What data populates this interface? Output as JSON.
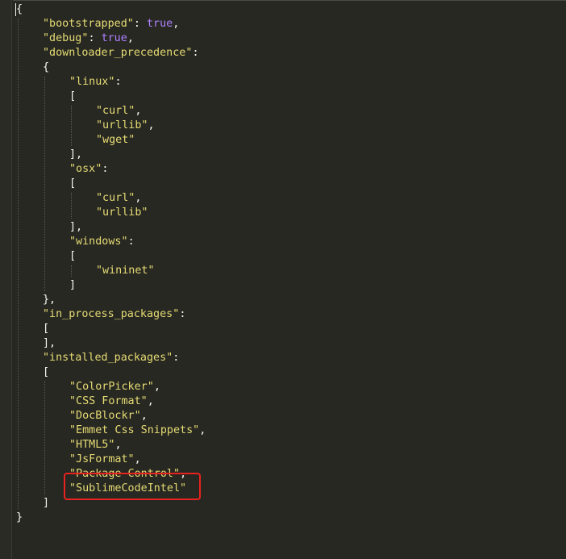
{
  "editor": {
    "lines": [
      {
        "indent": 0,
        "parts": [
          {
            "t": "{",
            "c": "punc"
          }
        ]
      },
      {
        "indent": 1,
        "parts": [
          {
            "t": "\"bootstrapped\"",
            "c": "str"
          },
          {
            "t": ": ",
            "c": "punc"
          },
          {
            "t": "true",
            "c": "kw"
          },
          {
            "t": ",",
            "c": "punc"
          }
        ]
      },
      {
        "indent": 1,
        "parts": [
          {
            "t": "\"debug\"",
            "c": "str"
          },
          {
            "t": ": ",
            "c": "punc"
          },
          {
            "t": "true",
            "c": "kw"
          },
          {
            "t": ",",
            "c": "punc"
          }
        ]
      },
      {
        "indent": 1,
        "parts": [
          {
            "t": "\"downloader_precedence\"",
            "c": "str"
          },
          {
            "t": ":",
            "c": "punc"
          }
        ]
      },
      {
        "indent": 1,
        "parts": [
          {
            "t": "{",
            "c": "punc"
          }
        ]
      },
      {
        "indent": 2,
        "parts": [
          {
            "t": "\"linux\"",
            "c": "str"
          },
          {
            "t": ":",
            "c": "punc"
          }
        ]
      },
      {
        "indent": 2,
        "parts": [
          {
            "t": "[",
            "c": "punc"
          }
        ]
      },
      {
        "indent": 3,
        "parts": [
          {
            "t": "\"curl\"",
            "c": "str"
          },
          {
            "t": ",",
            "c": "punc"
          }
        ]
      },
      {
        "indent": 3,
        "parts": [
          {
            "t": "\"urllib\"",
            "c": "str"
          },
          {
            "t": ",",
            "c": "punc"
          }
        ]
      },
      {
        "indent": 3,
        "parts": [
          {
            "t": "\"wget\"",
            "c": "str"
          }
        ]
      },
      {
        "indent": 2,
        "parts": [
          {
            "t": "],",
            "c": "punc"
          }
        ]
      },
      {
        "indent": 2,
        "parts": [
          {
            "t": "\"osx\"",
            "c": "str"
          },
          {
            "t": ":",
            "c": "punc"
          }
        ]
      },
      {
        "indent": 2,
        "parts": [
          {
            "t": "[",
            "c": "punc"
          }
        ]
      },
      {
        "indent": 3,
        "parts": [
          {
            "t": "\"curl\"",
            "c": "str"
          },
          {
            "t": ",",
            "c": "punc"
          }
        ]
      },
      {
        "indent": 3,
        "parts": [
          {
            "t": "\"urllib\"",
            "c": "str"
          }
        ]
      },
      {
        "indent": 2,
        "parts": [
          {
            "t": "],",
            "c": "punc"
          }
        ]
      },
      {
        "indent": 2,
        "parts": [
          {
            "t": "\"windows\"",
            "c": "str"
          },
          {
            "t": ":",
            "c": "punc"
          }
        ]
      },
      {
        "indent": 2,
        "parts": [
          {
            "t": "[",
            "c": "punc"
          }
        ]
      },
      {
        "indent": 3,
        "parts": [
          {
            "t": "\"wininet\"",
            "c": "str"
          }
        ]
      },
      {
        "indent": 2,
        "parts": [
          {
            "t": "]",
            "c": "punc"
          }
        ]
      },
      {
        "indent": 1,
        "parts": [
          {
            "t": "},",
            "c": "punc"
          }
        ]
      },
      {
        "indent": 1,
        "parts": [
          {
            "t": "\"in_process_packages\"",
            "c": "str"
          },
          {
            "t": ":",
            "c": "punc"
          }
        ]
      },
      {
        "indent": 1,
        "parts": [
          {
            "t": "[",
            "c": "punc"
          }
        ]
      },
      {
        "indent": 1,
        "parts": [
          {
            "t": "],",
            "c": "punc"
          }
        ]
      },
      {
        "indent": 1,
        "parts": [
          {
            "t": "\"installed_packages\"",
            "c": "str"
          },
          {
            "t": ":",
            "c": "punc"
          }
        ]
      },
      {
        "indent": 1,
        "parts": [
          {
            "t": "[",
            "c": "punc"
          }
        ]
      },
      {
        "indent": 2,
        "parts": [
          {
            "t": "\"ColorPicker\"",
            "c": "str"
          },
          {
            "t": ",",
            "c": "punc"
          }
        ]
      },
      {
        "indent": 2,
        "parts": [
          {
            "t": "\"CSS Format\"",
            "c": "str"
          },
          {
            "t": ",",
            "c": "punc"
          }
        ]
      },
      {
        "indent": 2,
        "parts": [
          {
            "t": "\"DocBlockr\"",
            "c": "str"
          },
          {
            "t": ",",
            "c": "punc"
          }
        ]
      },
      {
        "indent": 2,
        "parts": [
          {
            "t": "\"Emmet Css Snippets\"",
            "c": "str"
          },
          {
            "t": ",",
            "c": "punc"
          }
        ]
      },
      {
        "indent": 2,
        "parts": [
          {
            "t": "\"HTML5\"",
            "c": "str"
          },
          {
            "t": ",",
            "c": "punc"
          }
        ]
      },
      {
        "indent": 2,
        "parts": [
          {
            "t": "\"JsFormat\"",
            "c": "str"
          },
          {
            "t": ",",
            "c": "punc"
          }
        ]
      },
      {
        "indent": 2,
        "parts": [
          {
            "t": "\"Package Control\"",
            "c": "str"
          },
          {
            "t": ",",
            "c": "punc"
          }
        ]
      },
      {
        "indent": 2,
        "parts": [
          {
            "t": "\"SublimeCodeIntel\"",
            "c": "str"
          }
        ]
      },
      {
        "indent": 1,
        "parts": [
          {
            "t": "]",
            "c": "punc"
          }
        ]
      },
      {
        "indent": 0,
        "parts": [
          {
            "t": "}",
            "c": "punc"
          }
        ]
      }
    ]
  },
  "colors": {
    "background": "#272822",
    "string": "#E6DB74",
    "keyword": "#AE81FF",
    "punctuation": "#F8F8F2",
    "highlight": "#E8221E"
  }
}
